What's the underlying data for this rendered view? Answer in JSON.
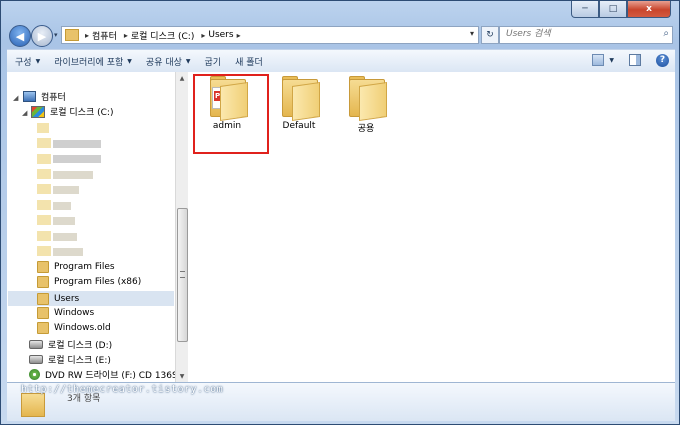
{
  "window": {
    "caption_buttons": {
      "minimize": "─",
      "maximize": "□",
      "close": "x"
    }
  },
  "nav": {
    "back": "◀",
    "forward": "▶",
    "history": "▾",
    "refresh": "↻",
    "breadcrumbs": [
      "컴퓨터",
      "로컬 디스크 (C:)",
      "Users"
    ],
    "sep": "▸",
    "address_dropdown": "▾",
    "search_placeholder": "Users 검색",
    "search_icon": "magnifier-icon"
  },
  "toolbar": {
    "items": [
      {
        "label": "구성",
        "has_arrow": true
      },
      {
        "label": "라이브러리에 포함",
        "has_arrow": true
      },
      {
        "label": "공유 대상",
        "has_arrow": true
      },
      {
        "label": "굽기",
        "has_arrow": false
      },
      {
        "label": "새 폴더",
        "has_arrow": false
      }
    ],
    "arrow": "▼",
    "views_arrow": "▼",
    "help": "?"
  },
  "tree": {
    "computer": "컴퓨터",
    "local_c": "로컬 디스크 (C:)",
    "folders": [
      "Program Files",
      "Program Files (x86)",
      "Users",
      "Windows",
      "Windows.old"
    ],
    "selected": "Users",
    "local_d": "로컬 디스크 (D:)",
    "local_e": "로컬 디스크 (E:)",
    "dvd": "DVD RW 드라이브 (F:) CD 136S"
  },
  "content": {
    "items": [
      {
        "name": "admin",
        "highlighted": true,
        "badge": "PSD"
      },
      {
        "name": "Default",
        "highlighted": false
      },
      {
        "name": "공용",
        "highlighted": false
      }
    ]
  },
  "details": {
    "count": "3개 항목",
    "watermark": "http://themecreator.tistory.com"
  },
  "colors": {
    "highlight": "#e0211c",
    "selected_row": "#d9e4f1",
    "frame": "#a9c4e6"
  }
}
